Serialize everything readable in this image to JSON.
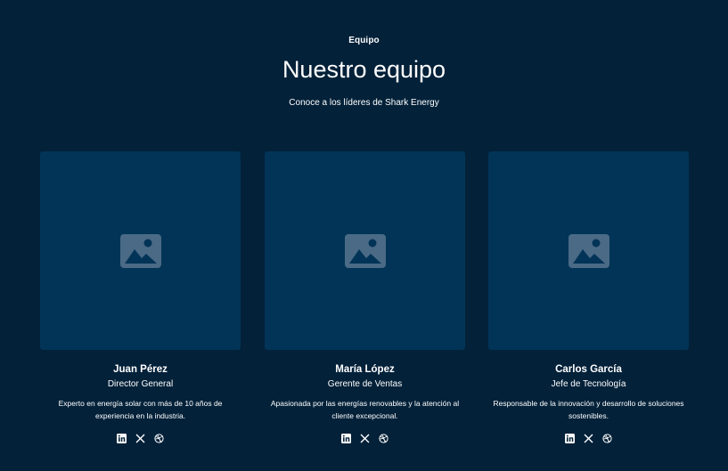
{
  "section": {
    "eyebrow": "Equipo",
    "title": "Nuestro equipo",
    "subtitle": "Conoce a los líderes de Shark Energy"
  },
  "team": [
    {
      "name": "Juan Pérez",
      "role": "Director General",
      "bio": "Experto en energía solar con más de 10 años de experiencia en la industria.",
      "photo_icon": "image-placeholder-icon",
      "social_icons": [
        "linkedin-icon",
        "x-icon",
        "dribbble-icon"
      ]
    },
    {
      "name": "María López",
      "role": "Gerente de Ventas",
      "bio": "Apasionada por las energías renovables y la atención al cliente excepcional.",
      "photo_icon": "image-placeholder-icon",
      "social_icons": [
        "linkedin-icon",
        "x-icon",
        "dribbble-icon"
      ]
    },
    {
      "name": "Carlos García",
      "role": "Jefe de Tecnología",
      "bio": "Responsable de la innovación y desarrollo de soluciones sostenibles.",
      "photo_icon": "image-placeholder-icon",
      "social_icons": [
        "linkedin-icon",
        "x-icon",
        "dribbble-icon"
      ]
    }
  ],
  "colors": {
    "background": "#032139",
    "card_placeholder": "#023457",
    "placeholder_icon": "#4a6a86",
    "text": "#ffffff"
  }
}
